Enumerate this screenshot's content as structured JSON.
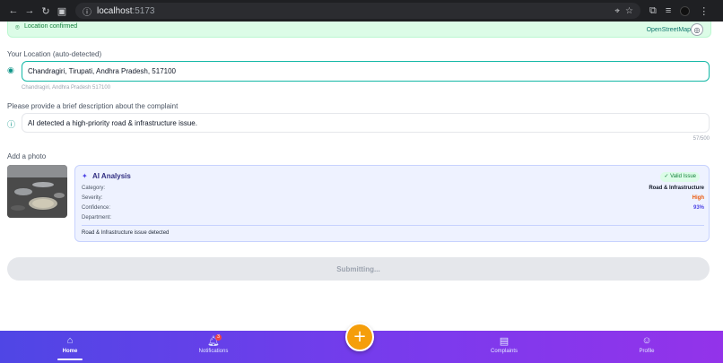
{
  "browser": {
    "url_host": "localhost",
    "url_port": ":5173"
  },
  "banner": {
    "status": "Location confirmed",
    "attribution": "OpenStreetMap"
  },
  "location": {
    "label": "Your Location (auto-detected)",
    "value": "Chandragiri, Tirupati, Andhra Pradesh, 517100",
    "sub": "Chandragiri, Andhra Pradesh 517100"
  },
  "description": {
    "label": "Please provide a brief description about the complaint",
    "value": "AI detected a high-priority road & infrastructure issue.",
    "counter": "57/500"
  },
  "photo": {
    "label": "Add a photo"
  },
  "ai": {
    "title": "AI Analysis",
    "badge": "✓ Valid Issue",
    "rows": [
      {
        "key": "Category:",
        "value": "Road & Infrastructure"
      },
      {
        "key": "Severity:",
        "value": "High"
      },
      {
        "key": "Confidence:",
        "value": "93%"
      },
      {
        "key": "Department:",
        "value": ""
      }
    ],
    "summary": "Road & Infrastructure issue detected"
  },
  "submit": {
    "label": "Submitting..."
  },
  "nav": {
    "home": "Home",
    "notifications": "Notifications",
    "notifications_count": "3",
    "complaints": "Complaints",
    "profile": "Profile",
    "fab": "+"
  },
  "colors": {
    "accent": "#14b8a6",
    "nav_start": "#4f46e5",
    "nav_end": "#9333ea",
    "fab": "#f59e0b"
  }
}
